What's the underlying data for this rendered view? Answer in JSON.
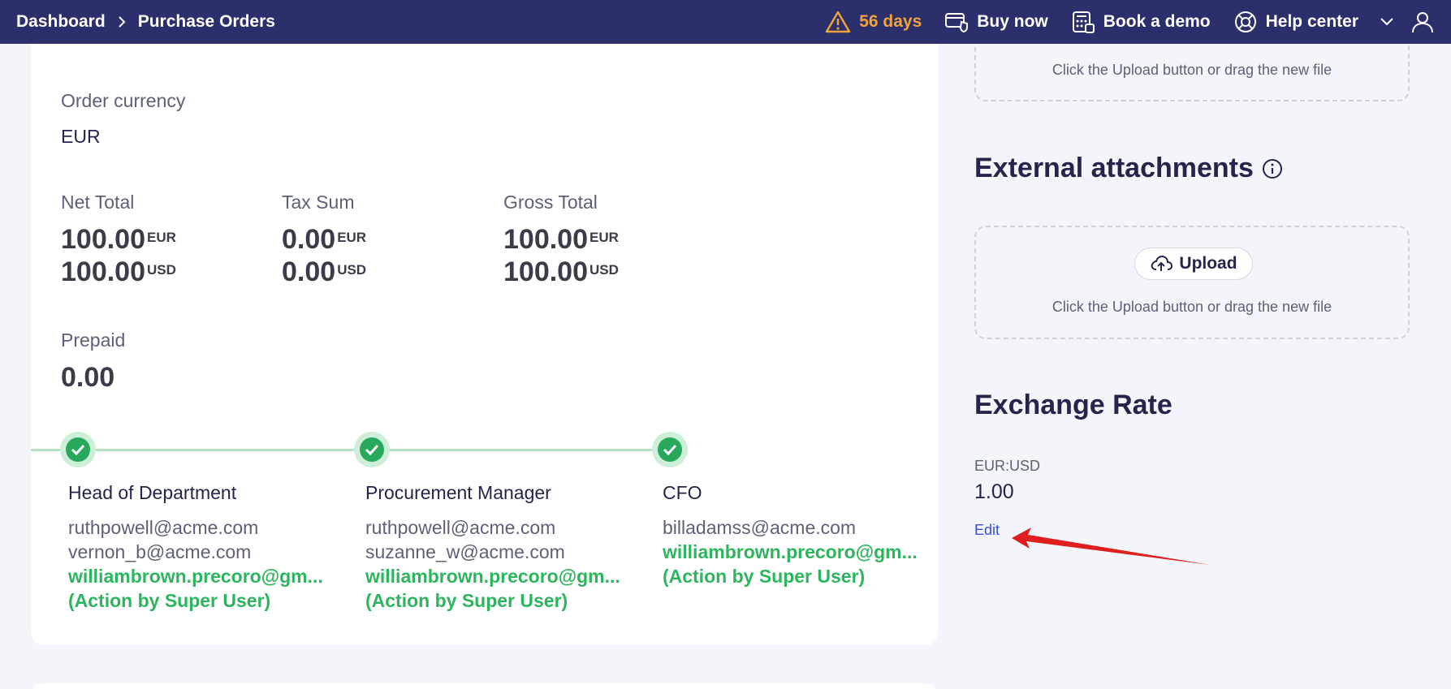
{
  "topbar": {
    "breadcrumbs": [
      "Dashboard",
      "Purchase Orders"
    ],
    "trial_text": "56 days",
    "buy_now": "Buy now",
    "book_demo": "Book a demo",
    "help_center": "Help center"
  },
  "order": {
    "currency_label": "Order currency",
    "currency_value": "EUR",
    "net_total_label": "Net Total",
    "net_total_eur": "100.00",
    "net_total_usd": "100.00",
    "tax_sum_label": "Tax Sum",
    "tax_sum_eur": "0.00",
    "tax_sum_usd": "0.00",
    "gross_total_label": "Gross Total",
    "gross_total_eur": "100.00",
    "gross_total_usd": "100.00",
    "eur": "EUR",
    "usd": "USD",
    "prepaid_label": "Prepaid",
    "prepaid_value": "0.00"
  },
  "approvals": [
    {
      "title": "Head of Department",
      "lines": [
        "ruthpowell@acme.com",
        "vernon_b@acme.com"
      ],
      "actor": "williambrown.precoro@gm...",
      "note": "(Action by Super User)"
    },
    {
      "title": "Procurement Manager",
      "lines": [
        "ruthpowell@acme.com",
        "suzanne_w@acme.com"
      ],
      "actor": "williambrown.precoro@gm...",
      "note": "(Action by Super User)"
    },
    {
      "title": "CFO",
      "lines": [
        "billadamss@acme.com"
      ],
      "actor": "williambrown.precoro@gm...",
      "note": "(Action by Super User)"
    }
  ],
  "attachments": {
    "top_hint": "Click the Upload button or drag the new file",
    "external_title": "External attachments",
    "upload_label": "Upload",
    "external_hint": "Click the Upload button or drag the new file"
  },
  "exchange": {
    "title": "Exchange Rate",
    "pair": "EUR:USD",
    "rate": "1.00",
    "edit_label": "Edit"
  },
  "colors": {
    "topbar": "#2b2f6b",
    "trial": "#f2a13b",
    "success": "#27a85a",
    "link": "#3550d6",
    "annotation_arrow": "#e01e1e"
  }
}
